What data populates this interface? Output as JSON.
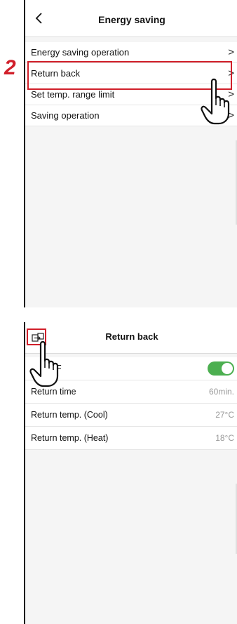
{
  "step_label": "2",
  "screen1": {
    "title": "Energy saving",
    "items": [
      {
        "label": "Energy saving operation"
      },
      {
        "label": "Return back"
      },
      {
        "label": "Set temp. range limit"
      },
      {
        "label": "Saving operation"
      }
    ],
    "chevron": ">",
    "back_icon": "chevron-left-icon"
  },
  "screen2": {
    "title": "Return back",
    "header_icon": "exit-icon",
    "on_off_label": "F",
    "toggle_state": "on",
    "rows": [
      {
        "label": "Return time",
        "value": "60min."
      },
      {
        "label": "Return temp. (Cool)",
        "value": "27°C"
      },
      {
        "label": "Return temp. (Heat)",
        "value": "18°C"
      }
    ]
  },
  "colors": {
    "accent_red": "#d11f2a",
    "toggle_green": "#4caf50",
    "background_grey": "#f5f5f5"
  },
  "pointer_icon": "hand-pointer-icon"
}
